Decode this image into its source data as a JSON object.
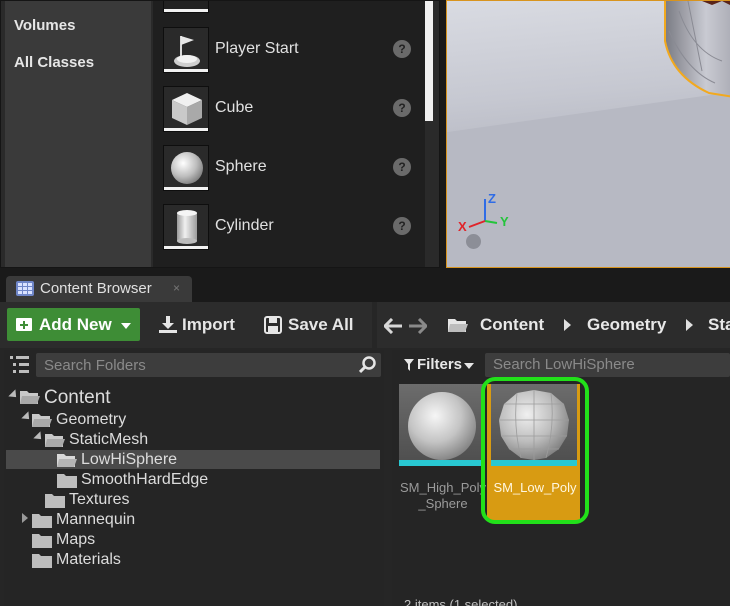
{
  "place_actors": {
    "categories": [
      "Volumes",
      "All Classes"
    ],
    "items": [
      {
        "label": "Player Start",
        "icon": "player-start-icon"
      },
      {
        "label": "Cube",
        "icon": "cube-icon"
      },
      {
        "label": "Sphere",
        "icon": "sphere-icon"
      },
      {
        "label": "Cylinder",
        "icon": "cylinder-icon"
      }
    ],
    "help_glyph": "?"
  },
  "viewport": {
    "axis_labels": {
      "z": "Z",
      "y": "Y",
      "x": "X"
    },
    "colors": {
      "selection_outline": "#f2a91e",
      "axis_x": "#e0242a",
      "axis_y": "#23c43b",
      "axis_z": "#2f6ce6"
    }
  },
  "content_browser": {
    "tab_label": "Content Browser",
    "tab_close": "×",
    "toolbar": {
      "add_new_label": "Add New",
      "import_label": "Import",
      "save_all_label": "Save All"
    },
    "breadcrumbs": [
      "Content",
      "Geometry",
      "Sta"
    ],
    "folder_search_placeholder": "Search Folders",
    "tree": [
      {
        "label": "Content",
        "level": 0,
        "expanded": true
      },
      {
        "label": "Geometry",
        "level": 1,
        "expanded": true
      },
      {
        "label": "StaticMesh",
        "level": 2,
        "expanded": true
      },
      {
        "label": "LowHiSphere",
        "level": 3,
        "selected": true
      },
      {
        "label": "SmoothHardEdge",
        "level": 3
      },
      {
        "label": "Textures",
        "level": 2
      },
      {
        "label": "Mannequin",
        "level": 1,
        "collapsed": true
      },
      {
        "label": "Maps",
        "level": 1
      },
      {
        "label": "Materials",
        "level": 1
      }
    ],
    "filters_label": "Filters",
    "asset_search_placeholder": "Search LowHiSphere",
    "assets": [
      {
        "name_line1": "SM_High_Poly",
        "name_line2": "_Sphere",
        "selected": false
      },
      {
        "name_line1": "SM_Low_Poly",
        "name_line2": "",
        "selected": true
      }
    ],
    "status_text": "2 items (1 selected)",
    "colors": {
      "add_new": "#3e8d36",
      "asset_type_bar": "#29c8d2",
      "selected_tile": "#d89b12",
      "highlight_ring": "#22e01a"
    }
  }
}
